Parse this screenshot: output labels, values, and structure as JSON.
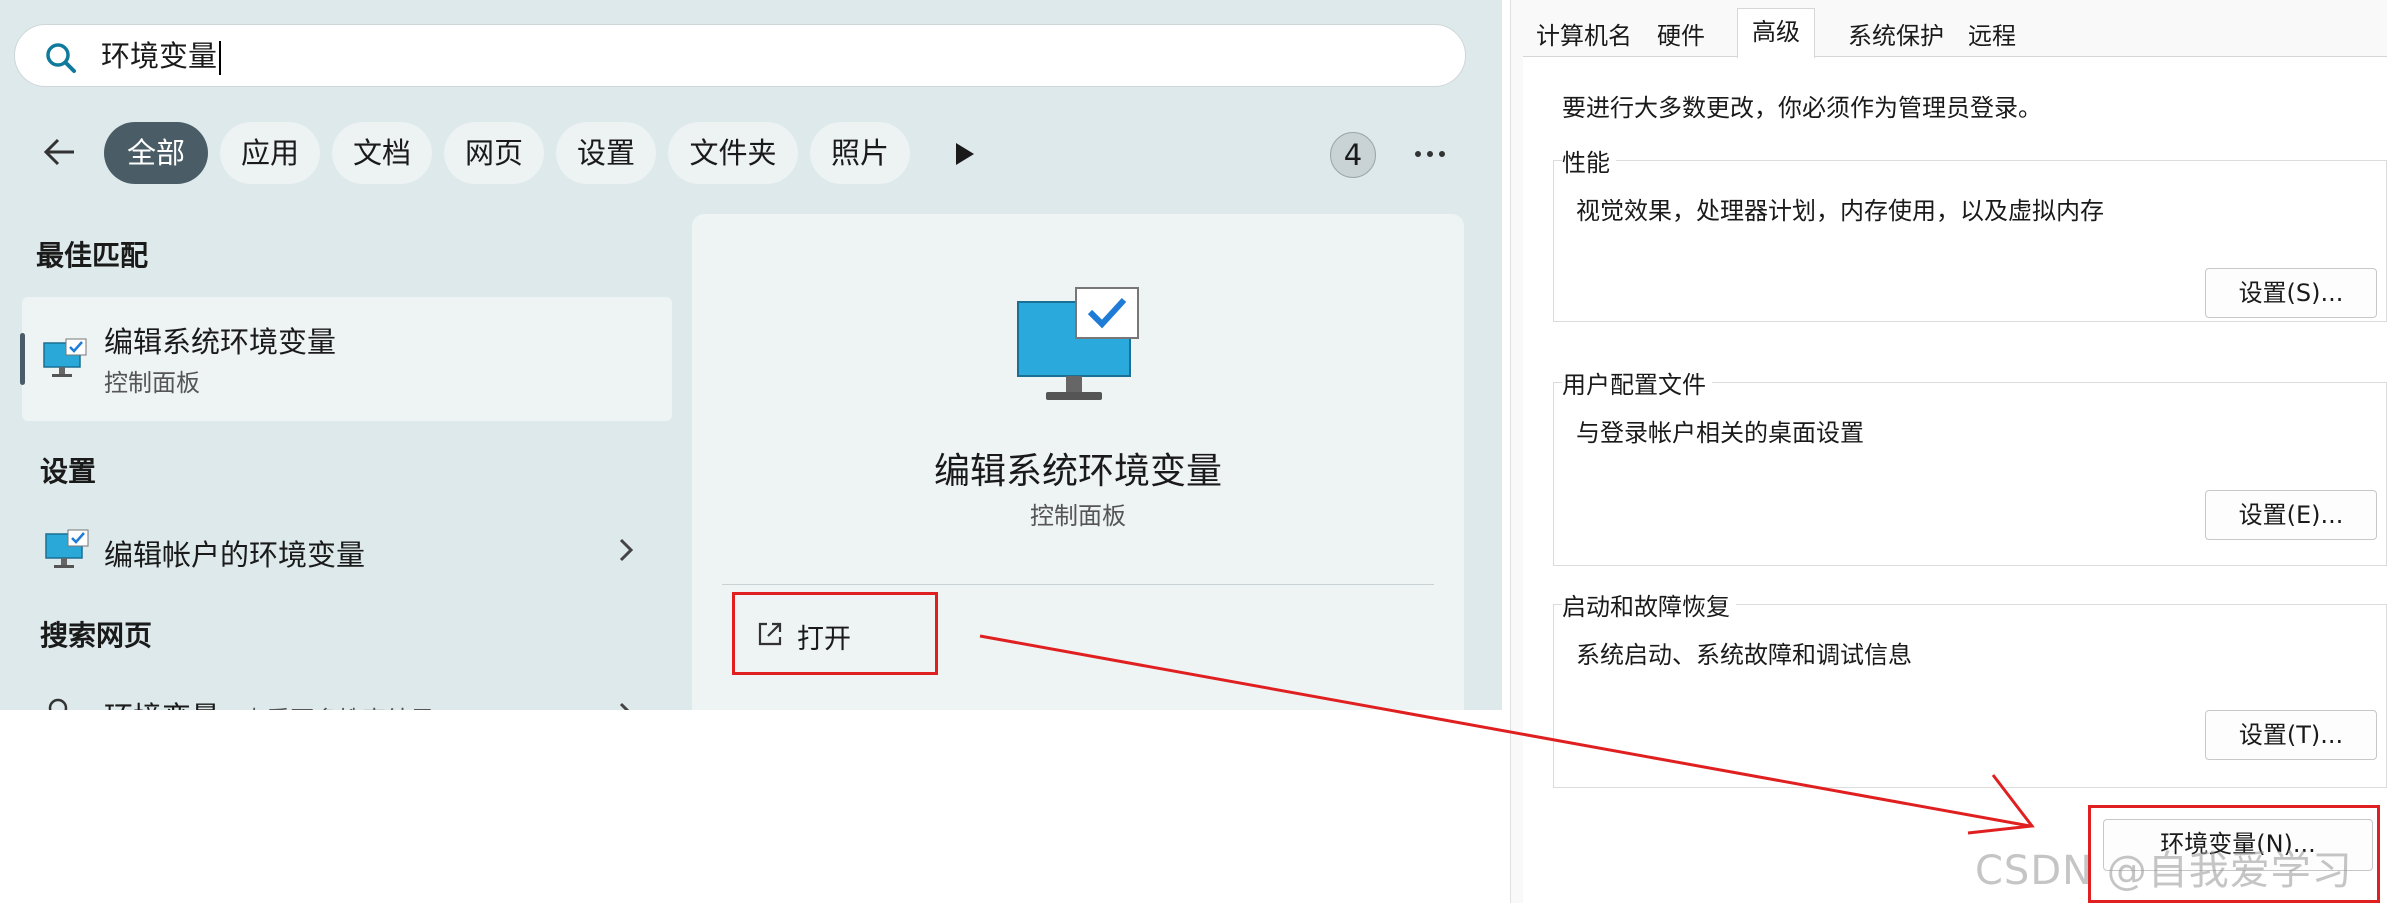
{
  "search": {
    "query": "环境变量"
  },
  "filters": {
    "chips": [
      "全部",
      "应用",
      "文档",
      "网页",
      "设置",
      "文件夹",
      "照片"
    ],
    "count": "4"
  },
  "results": {
    "best_match_heading": "最佳匹配",
    "best_match": {
      "title": "编辑系统环境变量",
      "subtitle": "控制面板"
    },
    "settings_heading": "设置",
    "settings_item": {
      "title": "编辑帐户的环境变量"
    },
    "web_heading": "搜索网页",
    "web_item": {
      "title": "环境变量",
      "subtitle": "- 查看更多搜索结果"
    }
  },
  "detail": {
    "title": "编辑系统环境变量",
    "subtitle": "控制面板",
    "open_label": "打开"
  },
  "system_properties": {
    "tabs": [
      "计算机名",
      "硬件",
      "高级",
      "系统保护",
      "远程"
    ],
    "active_tab": "高级",
    "notice": "要进行大多数更改，你必须作为管理员登录。",
    "performance": {
      "label": "性能",
      "description": "视觉效果，处理器计划，内存使用，以及虚拟内存",
      "button": "设置(S)..."
    },
    "user_profiles": {
      "label": "用户配置文件",
      "description": "与登录帐户相关的桌面设置",
      "button": "设置(E)..."
    },
    "startup_recovery": {
      "label": "启动和故障恢复",
      "description": "系统启动、系统故障和调试信息",
      "button": "设置(T)..."
    },
    "env_button": "环境变量(N)..."
  },
  "watermark": "CSDN @自我爱学习",
  "colors": {
    "highlight": "#e02020",
    "active_chip": "#4a5d66",
    "panel_bg": "#dde9ea"
  }
}
